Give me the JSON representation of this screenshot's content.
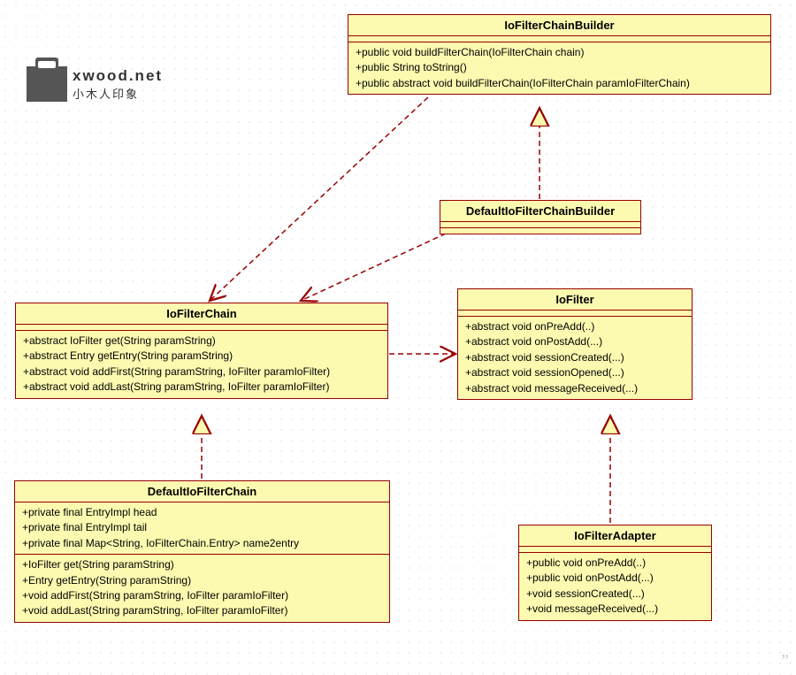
{
  "logo": {
    "line1": "xwood.net",
    "line2": "小木人印象"
  },
  "classes": {
    "ioFilterChainBuilder": {
      "title": "IoFilterChainBuilder",
      "methods": [
        "+public void buildFilterChain(IoFilterChain chain)",
        "+public String toString()",
        "+public abstract void buildFilterChain(IoFilterChain paramIoFilterChain)"
      ]
    },
    "defaultIoFilterChainBuilder": {
      "title": "DefaultIoFilterChainBuilder"
    },
    "ioFilterChain": {
      "title": "IoFilterChain",
      "methods": [
        "+abstract IoFilter get(String paramString)",
        "+abstract Entry getEntry(String paramString)",
        "+abstract void addFirst(String paramString, IoFilter paramIoFilter)",
        "+abstract void addLast(String paramString, IoFilter paramIoFilter)"
      ]
    },
    "ioFilter": {
      "title": "IoFilter",
      "methods": [
        "+abstract void onPreAdd(..)",
        "+abstract void onPostAdd(...)",
        "+abstract void sessionCreated(...)",
        "+abstract void sessionOpened(...)",
        "+abstract void messageReceived(...)"
      ]
    },
    "defaultIoFilterChain": {
      "title": "DefaultIoFilterChain",
      "attributes": [
        "+private final EntryImpl head",
        "+private final EntryImpl tail",
        "+private final Map<String, IoFilterChain.Entry> name2entry"
      ],
      "methods": [
        "+IoFilter get(String paramString)",
        "+Entry getEntry(String paramString)",
        "+void addFirst(String paramString, IoFilter paramIoFilter)",
        "+void addLast(String paramString, IoFilter paramIoFilter)"
      ]
    },
    "ioFilterAdapter": {
      "title": "IoFilterAdapter",
      "methods": [
        "+public void onPreAdd(..)",
        "+public void onPostAdd(...)",
        "+void sessionCreated(...)",
        "+void messageReceived(...)"
      ]
    }
  }
}
